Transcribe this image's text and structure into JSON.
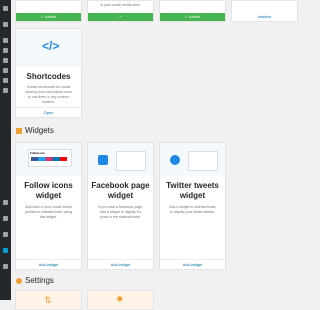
{
  "sidebar": {
    "items": [
      "dashboard-icon",
      "posts-icon",
      "media-icon",
      "pages-icon",
      "comments-icon",
      "appearance-icon",
      "plugins-icon",
      "users-icon",
      "tools-icon",
      "settings-icon"
    ]
  },
  "top_cards": [
    {
      "status": "Active"
    },
    {
      "desc": "to your social media sites."
    },
    {
      "status": "Active"
    },
    {
      "link": "Inactive"
    }
  ],
  "shortcodes": {
    "title": "Shortcodes",
    "desc": "Create shortcodes for social sharing icons and follow icons to use them in any custom location.",
    "action": "Open"
  },
  "widgets": {
    "heading": "Widgets",
    "cards": [
      {
        "title_1": "Follow icons",
        "title_2": "widget",
        "thumb_text": "Follow me",
        "desc": "Add links of your social media profiles to sidebar/footer using this widget.",
        "action": "Add widget"
      },
      {
        "title_1": "Facebook page",
        "title_2": "widget",
        "desc": "If you have a facebook page, add a widget to display it's posts in the sidebar/footer.",
        "action": "Add widget"
      },
      {
        "title_1": "Twitter tweets",
        "title_2": "widget",
        "desc": "Add a widget to sidebar/footer to display your twitter tweets.",
        "action": "Add widget"
      }
    ]
  },
  "settings": {
    "heading": "Settings"
  }
}
